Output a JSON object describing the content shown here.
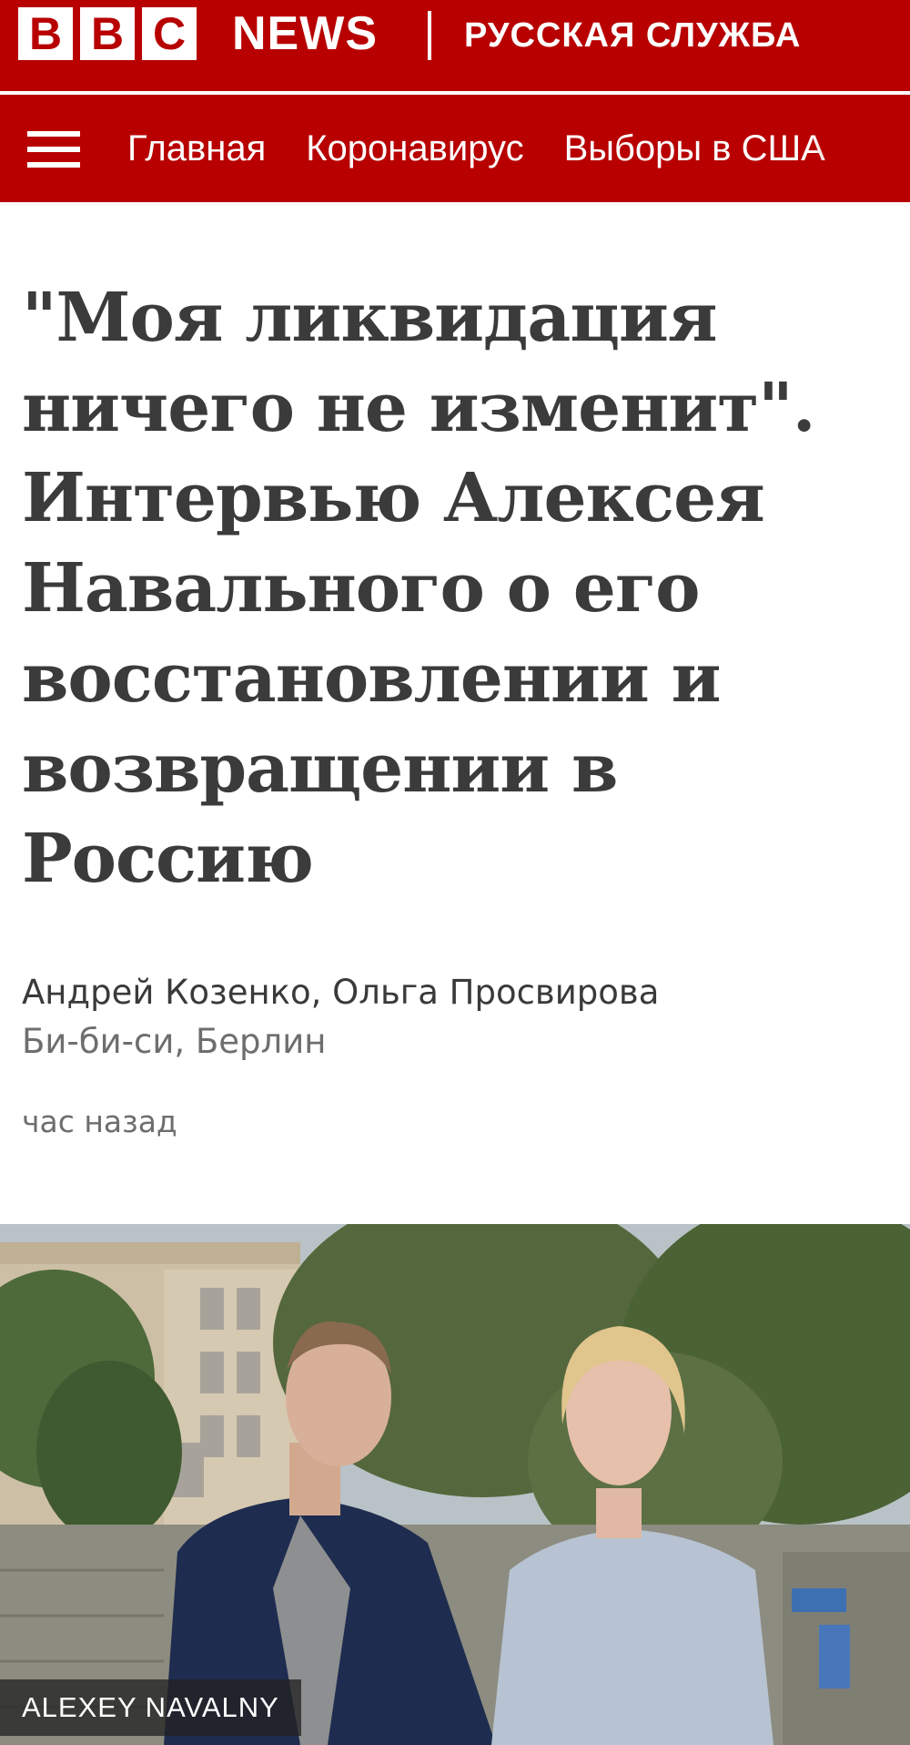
{
  "masthead": {
    "brand_letters": [
      "B",
      "B",
      "C"
    ],
    "news_label": "NEWS",
    "service_label": "РУССКАЯ СЛУЖБА",
    "brand_color": "#b80000"
  },
  "nav": {
    "menu_icon": "hamburger-menu-icon",
    "items": [
      "Главная",
      "Коронавирус",
      "Выборы в США"
    ]
  },
  "article": {
    "headline": "\"Моя ликвидация ничего не изменит\". Интервью Алексея Навального о его восстановлении и возвращении в Россию",
    "authors": "Андрей Козенко, Ольга Просвирова",
    "author_role": "Би-би-си, Берлин",
    "timestamp": "час назад"
  },
  "photo": {
    "caption": "ALEXEY NAVALNY"
  }
}
